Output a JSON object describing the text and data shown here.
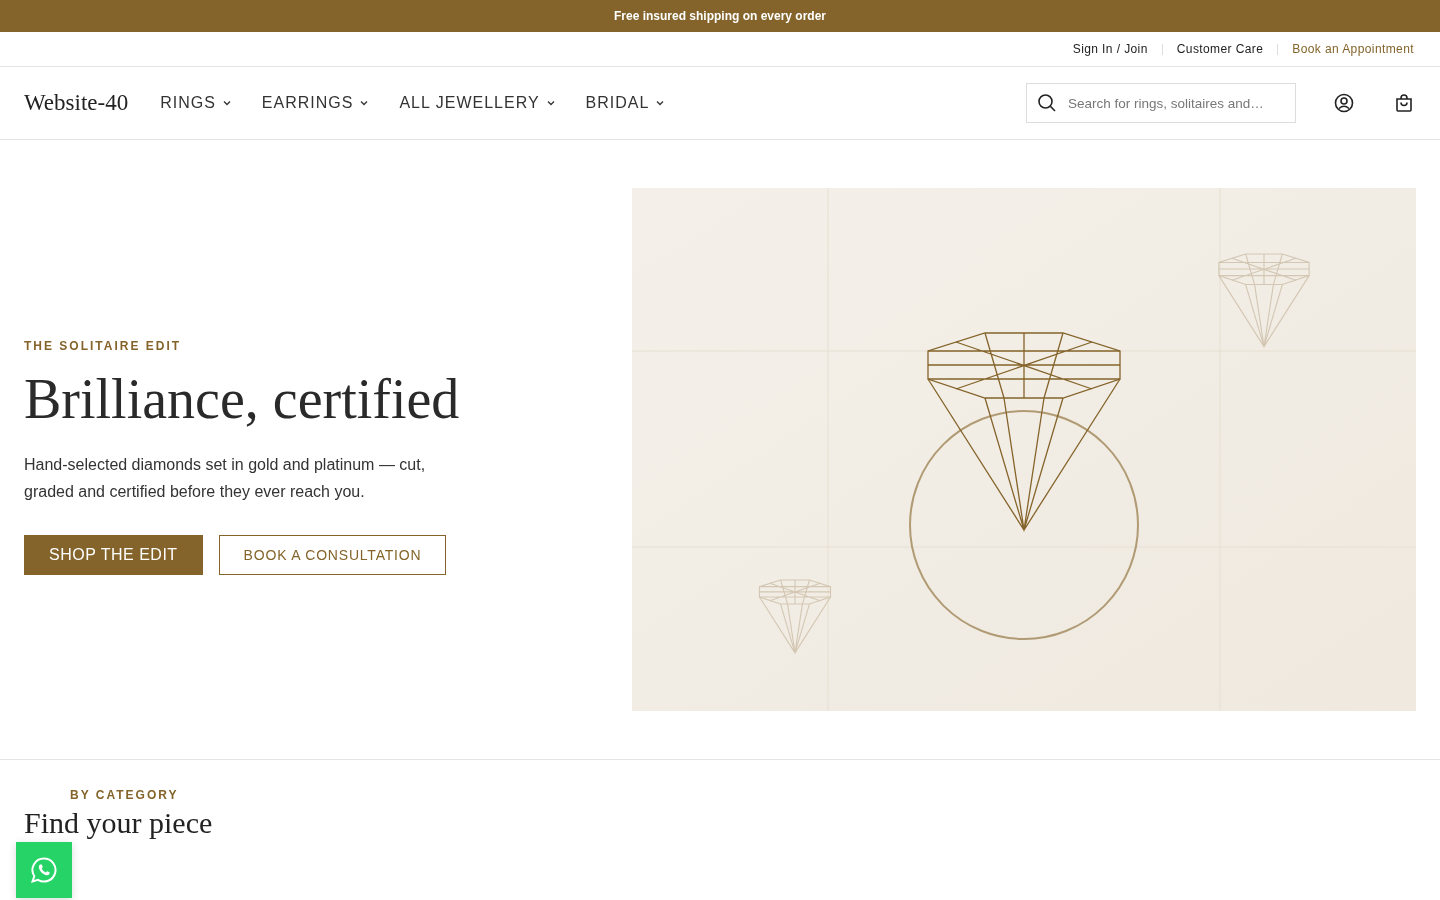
{
  "announcement": "Free insured shipping on every order",
  "utility_links": [
    {
      "label": "Sign In / Join",
      "kind": "plain"
    },
    {
      "label": "Customer Care",
      "kind": "plain"
    },
    {
      "label": "Book an Appointment",
      "kind": "accent"
    }
  ],
  "logo": "Website-40",
  "nav": [
    {
      "label": "RINGS"
    },
    {
      "label": "EARRINGS"
    },
    {
      "label": "ALL JEWELLERY"
    },
    {
      "label": "BRIDAL"
    }
  ],
  "search": {
    "placeholder": "Search for rings, solitaires and…"
  },
  "hero": {
    "eyebrow": "THE SOLITAIRE EDIT",
    "title": "Brilliance, certified",
    "text": "Hand-selected diamonds set in gold and platinum — cut, graded and certified before they ever reach you.",
    "buttons": [
      {
        "label": "SHOP THE EDIT",
        "kind": "primary"
      },
      {
        "label": "BOOK A CONSULTATION",
        "kind": "outline"
      }
    ]
  },
  "category": {
    "eyebrow": "BY CATEGORY",
    "title": "Find your piece"
  }
}
